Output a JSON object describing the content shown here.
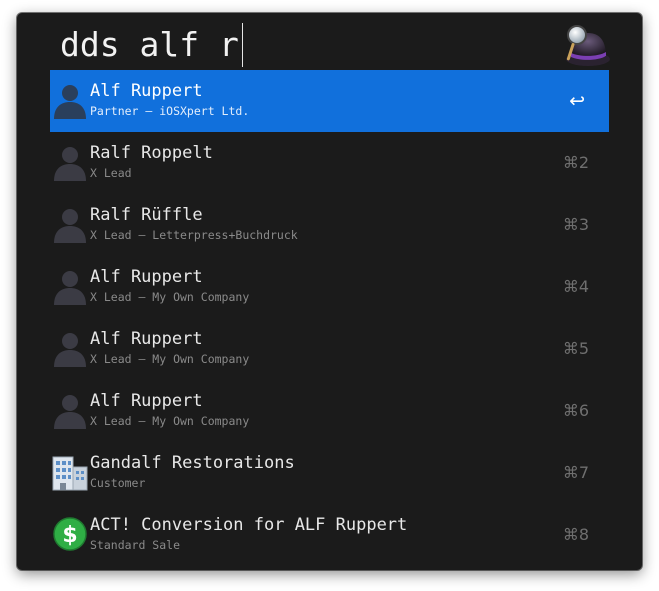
{
  "search": {
    "query": "dds alf r"
  },
  "app_icon": "alfred-hat-icon",
  "results": [
    {
      "title": "Alf Ruppert",
      "subtitle": "Partner – iOSXpert Ltd.",
      "shortcut": "↩",
      "icon": "person-icon",
      "selected": true
    },
    {
      "title": "Ralf Roppelt",
      "subtitle": "X Lead",
      "shortcut": "⌘2",
      "icon": "person-icon",
      "selected": false
    },
    {
      "title": "Ralf Rüffle",
      "subtitle": "X Lead – Letterpress+Buchdruck",
      "shortcut": "⌘3",
      "icon": "person-icon",
      "selected": false
    },
    {
      "title": "Alf Ruppert",
      "subtitle": "X Lead – My Own Company",
      "shortcut": "⌘4",
      "icon": "person-icon",
      "selected": false
    },
    {
      "title": "Alf Ruppert",
      "subtitle": "X Lead – My Own Company",
      "shortcut": "⌘5",
      "icon": "person-icon",
      "selected": false
    },
    {
      "title": "Alf Ruppert",
      "subtitle": "X Lead – My Own Company",
      "shortcut": "⌘6",
      "icon": "person-icon",
      "selected": false
    },
    {
      "title": "Gandalf Restorations",
      "subtitle": "Customer",
      "shortcut": "⌘7",
      "icon": "building-icon",
      "selected": false
    },
    {
      "title": "ACT! Conversion for ALF Ruppert",
      "subtitle": "Standard Sale",
      "shortcut": "⌘8",
      "icon": "dollar-icon",
      "selected": false
    }
  ],
  "colors": {
    "window_bg": "#1b1b1b",
    "selection": "#1170dc",
    "title_text": "#e8e8e8",
    "subtitle_text": "#8a8a8a",
    "shortcut_text": "#6f6f6f",
    "dollar_green": "#2fae45"
  }
}
